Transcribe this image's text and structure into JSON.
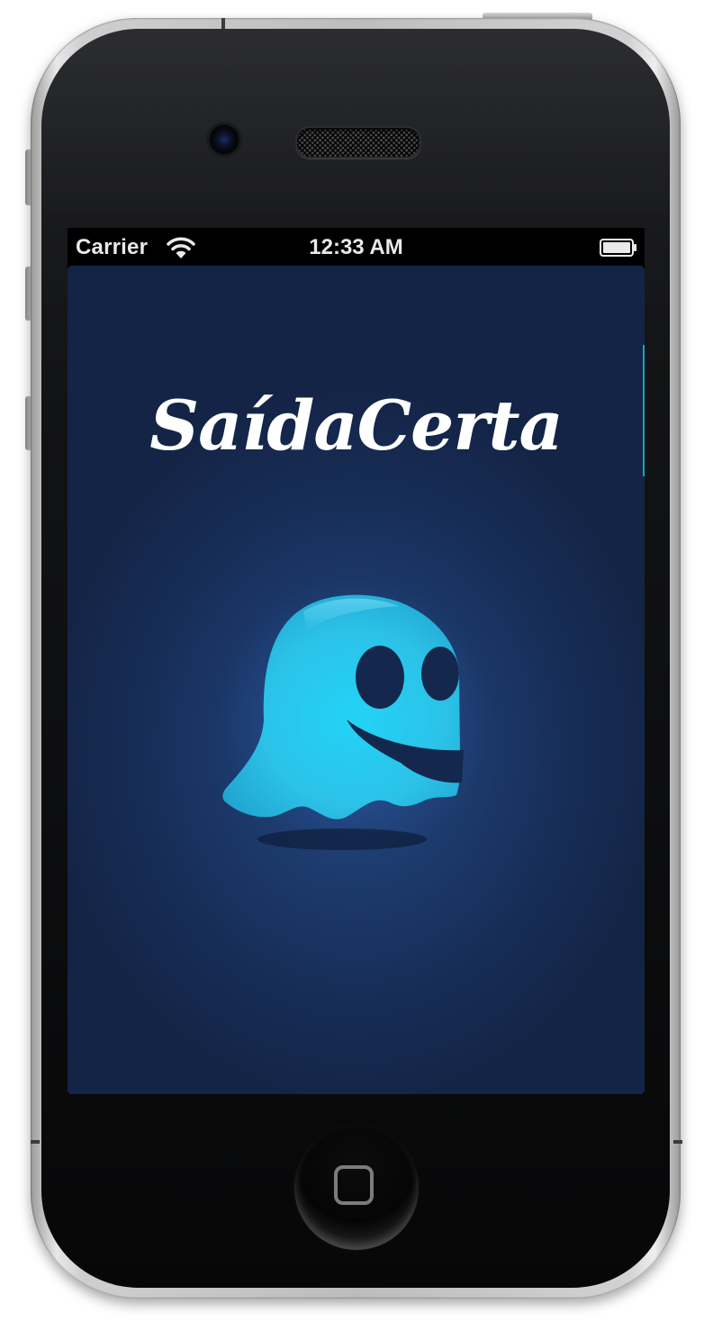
{
  "status_bar": {
    "carrier": "Carrier",
    "time": "12:33 AM",
    "wifi_icon": "wifi-icon",
    "battery_icon": "battery-icon",
    "background": "#000000",
    "text_color": "#e9e9e9"
  },
  "app": {
    "logo_text": "SaídaCerta",
    "mascot_icon": "ghost-icon",
    "background_color": "#1b3565",
    "mascot_color": "#27c3ea",
    "logo_color": "#ffffff"
  },
  "device": {
    "home_button_icon": "home-square-icon",
    "frame_color": "#c4c4c4"
  }
}
